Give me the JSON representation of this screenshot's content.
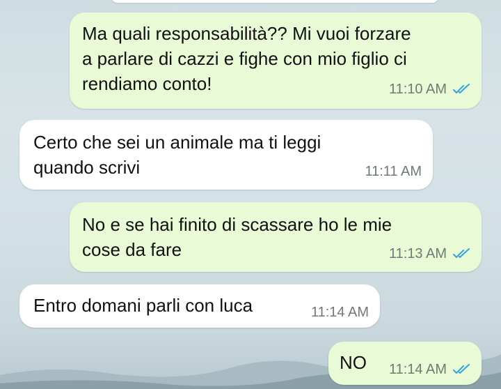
{
  "messages": [
    {
      "direction": "outgoing",
      "text": "Ma quali responsabilità?? Mi vuoi forzare\na parlare di cazzi e fighe con mio figlio ci\nrendiamo conto!",
      "time": "11:10 AM",
      "status_icon": "double-check-read-icon"
    },
    {
      "direction": "incoming",
      "text": "Certo che sei un animale ma ti leggi\nquando scrivi",
      "time": "11:11 AM"
    },
    {
      "direction": "outgoing",
      "text": "No e se hai finito di scassare ho le mie\ncose da fare",
      "time": "11:13 AM",
      "status_icon": "double-check-read-icon"
    },
    {
      "direction": "incoming",
      "text": "Entro domani parli con luca",
      "time": "11:14 AM"
    },
    {
      "direction": "outgoing",
      "text": "NO",
      "time": "11:14 AM",
      "status_icon": "double-check-read-icon"
    }
  ],
  "colors": {
    "outgoing_bubble": "#e8fbd6",
    "incoming_bubble": "#ffffff",
    "read_ticks": "#34a3df",
    "timestamp": "#6f7a75"
  }
}
